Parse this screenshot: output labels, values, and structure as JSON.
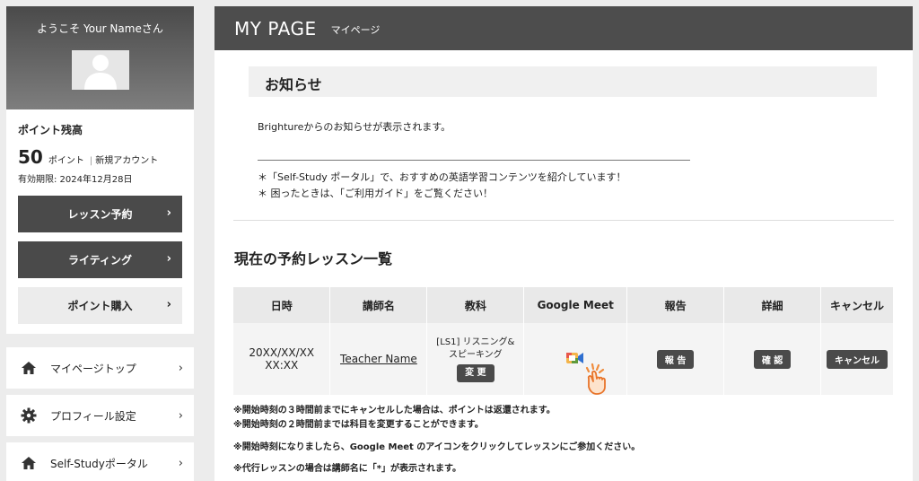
{
  "sidebar": {
    "welcome": "ようこそ Your Nameさん",
    "points_title": "ポイント残高",
    "points_value": "50",
    "points_unit": "ポイント",
    "points_sep": "|",
    "account_type": "新規アカウント",
    "expiry": "有効期限: 2024年12月28日",
    "buttons": [
      {
        "label": "レッスン予約"
      },
      {
        "label": "ライティング"
      },
      {
        "label": "ポイント購入"
      }
    ],
    "nav": [
      {
        "label": "マイページトップ",
        "icon": "home-icon"
      },
      {
        "label": "プロフィール設定",
        "icon": "gear-icon"
      },
      {
        "label": "Self-Studyポータル",
        "icon": "home-icon"
      }
    ],
    "arrow": "›"
  },
  "header": {
    "title": "MY PAGE",
    "subtitle": "マイページ"
  },
  "notice": {
    "heading": "お知らせ",
    "text": "Brightureからのお知らせが表示されます。",
    "note1": "＊「Self-Study ポータル」で、おすすめの英語学習コンテンツを紹介しています！",
    "note2": "＊ 困ったときは、「ご利用ガイド」をご覧ください！"
  },
  "lessons": {
    "title": "現在の予約レッスン一覧",
    "columns": [
      "日時",
      "講師名",
      "教科",
      "Google Meet",
      "報告",
      "詳細",
      "キャンセル"
    ],
    "row": {
      "date": "20XX/XX/XX",
      "time": "XX:XX",
      "teacher": "Teacher Name",
      "subject_line1": "[LS1] リスニング&",
      "subject_line2": "スピーキング",
      "change_label": "変 更",
      "report_label": "報 告",
      "detail_label": "確 認",
      "cancel_label": "キャンセル"
    },
    "rules": [
      "※開始時刻の３時間前までにキャンセルした場合は、ポイントは返還されます。",
      "※開始時刻の２時間前までは科目を変更することができます。",
      "※開始時刻になりましたら、Google Meet のアイコンをクリックしてレッスンにご参加ください。",
      "※代行レッスンの場合は講師名に「*」が表示されます。"
    ]
  },
  "colors": {
    "dark": "#4a4a4a",
    "accent": "#f08c3c"
  }
}
